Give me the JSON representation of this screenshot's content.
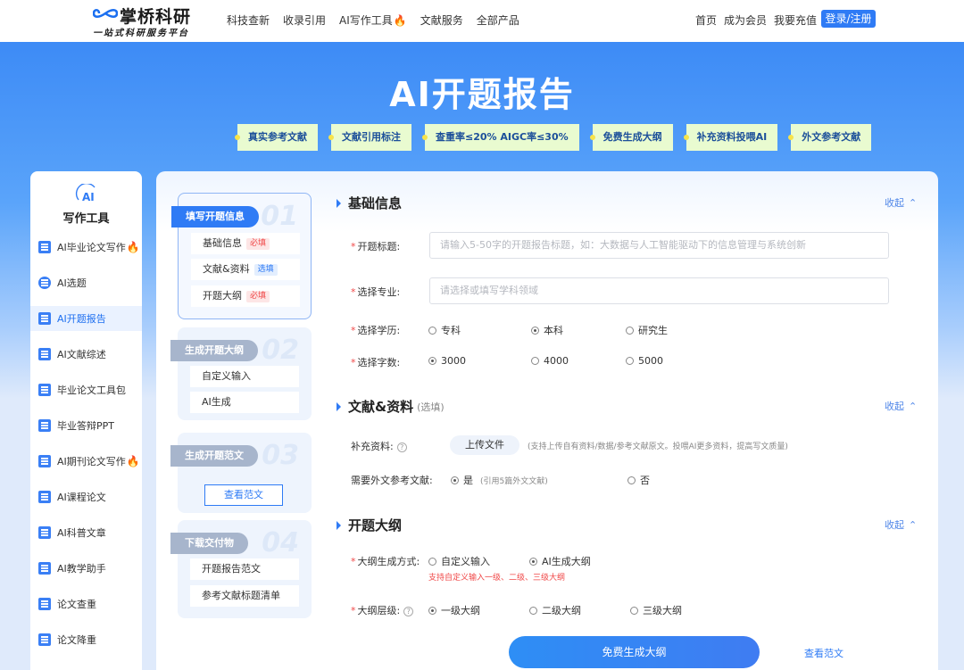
{
  "brand": {
    "name": "掌桥科研",
    "slogan": "一站式科研服务平台"
  },
  "nav": {
    "left": [
      {
        "label": "科技查新"
      },
      {
        "label": "收录引用"
      },
      {
        "label": "AI写作工具",
        "hot": true
      },
      {
        "label": "文献服务"
      },
      {
        "label": "全部产品"
      }
    ],
    "right": [
      "首页",
      "成为会员",
      "我要充值"
    ],
    "login": "登录/注册"
  },
  "hero": {
    "title": "AI开题报告",
    "tags": [
      "真实参考文献",
      "文献引用标注",
      "查重率≤20%  AIGC率≤30%",
      "免费生成大纲",
      "补充资料投喂AI",
      "外文参考文献"
    ]
  },
  "sidebar": {
    "logo_text": "AI",
    "title": "写作工具",
    "items": [
      {
        "label": "AI毕业论文写作",
        "hot": true
      },
      {
        "label": "AI选题"
      },
      {
        "label": "AI开题报告",
        "active": true
      },
      {
        "label": "AI文献综述"
      },
      {
        "label": "毕业论文工具包"
      },
      {
        "label": "毕业答辩PPT"
      },
      {
        "label": "AI期刊论文写作",
        "hot": true
      },
      {
        "label": "AI课程论文"
      },
      {
        "label": "AI科普文章"
      },
      {
        "label": "AI教学助手"
      },
      {
        "label": "论文查重"
      },
      {
        "label": "论文降重"
      }
    ]
  },
  "steps": [
    {
      "num": "01",
      "title": "填写开题信息",
      "active": true,
      "subs": [
        {
          "label": "基础信息",
          "pill": "必填",
          "pill_type": "req"
        },
        {
          "label": "文献&资料",
          "pill": "选填",
          "pill_type": "opt"
        },
        {
          "label": "开题大纲",
          "pill": "必填",
          "pill_type": "req"
        }
      ]
    },
    {
      "num": "02",
      "title": "生成开题大纲",
      "subs": [
        {
          "label": "自定义输入"
        },
        {
          "label": "AI生成"
        }
      ]
    },
    {
      "num": "03",
      "title": "生成开题范文",
      "button": "查看范文"
    },
    {
      "num": "04",
      "title": "下载交付物",
      "subs": [
        {
          "label": "开题报告范文"
        },
        {
          "label": "参考文献标题清单"
        }
      ]
    }
  ],
  "form": {
    "collapse_label": "收起",
    "basic": {
      "title": "基础信息",
      "topic_label": "开题标题:",
      "topic_placeholder": "请输入5-50字的开题报告标题，如：大数据与人工智能驱动下的信息管理与系统创新",
      "major_label": "选择专业:",
      "major_placeholder": "请选择或填写学科领域",
      "degree_label": "选择学历:",
      "degree_options": [
        "专科",
        "本科",
        "研究生"
      ],
      "degree_selected": 1,
      "words_label": "选择字数:",
      "words_options": [
        "3000",
        "4000",
        "5000"
      ],
      "words_selected": 0
    },
    "refs": {
      "title": "文献&资料",
      "note": "(选填)",
      "supp_label": "补充资料:",
      "upload_label": "上传文件",
      "upload_hint": "(支持上传自有资料/数据/参考文献原文。投喂AI更多资料，提高写文质量)",
      "foreign_label": "需要外文参考文献:",
      "yes": "是",
      "yes_hint": "(引用5篇外文文献)",
      "no": "否"
    },
    "outline": {
      "title": "开题大纲",
      "method_label": "大纲生成方式:",
      "method_options": [
        "自定义输入",
        "AI生成大纲"
      ],
      "method_selected": 1,
      "method_hint": "支持自定义输入一级、二级、三级大纲",
      "level_label": "大纲层级:",
      "level_options": [
        "一级大纲",
        "二级大纲",
        "三级大纲"
      ],
      "level_selected": 0
    },
    "generate_button": "免费生成大纲",
    "view_sample": "查看范文"
  },
  "colors": {
    "primary": "#2f7bf5",
    "required": "#f04848",
    "tag_bg": "#e9fbd0"
  }
}
